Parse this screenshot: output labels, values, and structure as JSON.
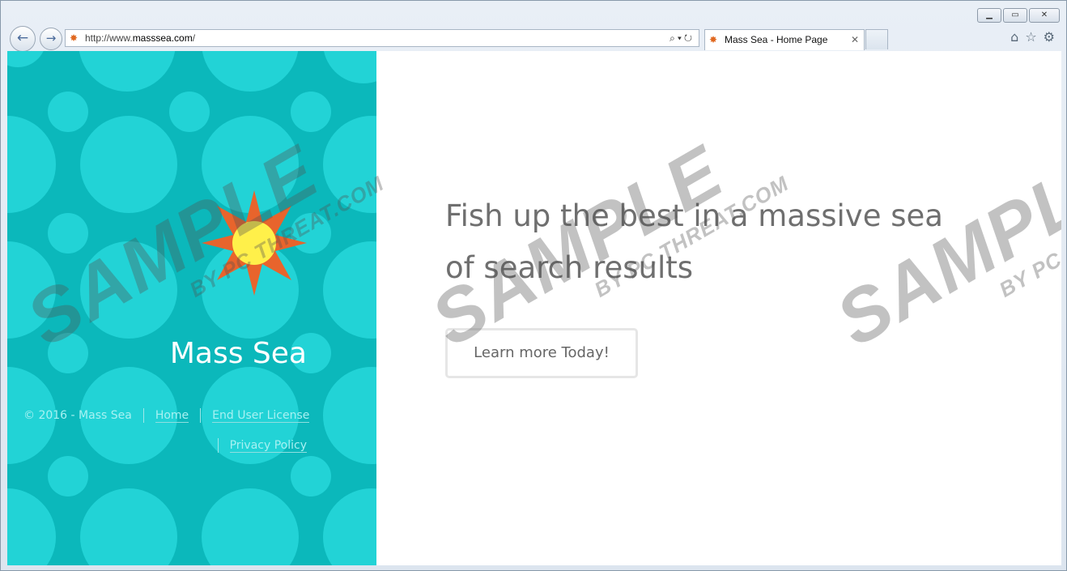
{
  "browser": {
    "back_icon": "←",
    "forward_icon": "→",
    "address": {
      "prefix": "http://www.",
      "domain": "masssea.com",
      "suffix": "/"
    },
    "address_tools": "⌕▾↻",
    "tab_title": "Mass Sea - Home Page",
    "tab_close": "✕",
    "window_controls": {
      "minimize": "▁",
      "maximize": "▭",
      "close": "✕"
    },
    "toolbar_icons": {
      "home": "⌂",
      "favorites": "☆",
      "settings": "⚙"
    }
  },
  "page": {
    "brand": "Mass Sea",
    "footer": {
      "copyright": "© 2016 - Mass Sea",
      "links": [
        "Home",
        "End User License",
        "Privacy Policy"
      ]
    },
    "tagline": "Fish up the best in a massive sea of search results",
    "cta_label": "Learn more Today!"
  },
  "watermark": {
    "main": "SAMPLE",
    "sub": "BY PC THREAT.COM"
  },
  "colors": {
    "panel_bg": "#0bb8bb",
    "dot": "#22d3d6",
    "sun_rays": "#e8642c",
    "sun_core": "#fff04a",
    "tagline": "#6f6f6f"
  }
}
